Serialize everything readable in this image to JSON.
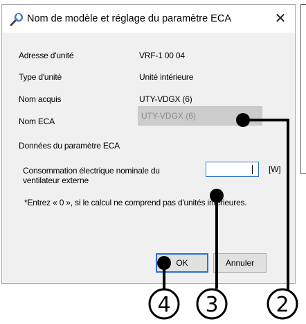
{
  "dialog": {
    "title": "Nom de modèle et réglage du paramètre ECA",
    "close_glyph": "✕"
  },
  "fields": [
    {
      "label": "Adresse d'unité",
      "value": "VRF-1 00 04"
    },
    {
      "label": "Type d'unité",
      "value": "Unité intérieure"
    },
    {
      "label": "Nom acquis",
      "value": "UTY-VDGX (6)"
    }
  ],
  "eca": {
    "label": "Nom ECA",
    "value": "UTY-VDGX (6)"
  },
  "eca_params": {
    "heading": "Données du paramètre ECA",
    "consumption_label_line1": "Consommation électrique nominale du",
    "consumption_label_line2": "ventilateur externe",
    "unit": "[W]",
    "input_value": "",
    "note": "*Entrez « 0 », si le calcul ne comprend pas d'unités intérieures."
  },
  "buttons": {
    "ok": "OK",
    "cancel": "Annuler"
  },
  "callouts": [
    "4",
    "3",
    "2"
  ],
  "icons": {
    "title_icon": "tool-icon",
    "close_icon": "close-icon"
  }
}
